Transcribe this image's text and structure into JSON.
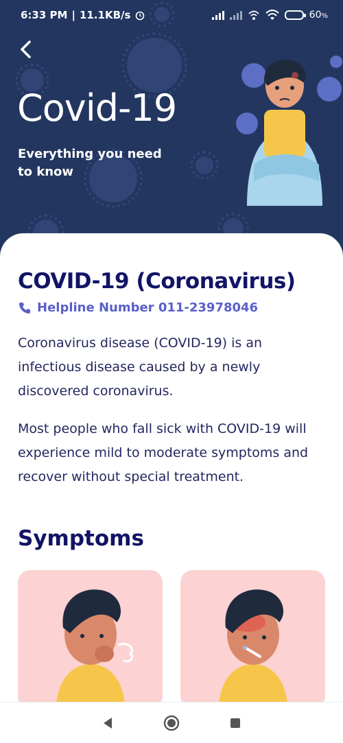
{
  "status": {
    "time": "6:33 PM",
    "speed": "11.1KB/s",
    "battery": "60",
    "battery_unit": "%",
    "battery_level": 0.6
  },
  "header": {
    "title": "Covid-19",
    "subtitle": "Everything you need to know"
  },
  "content": {
    "title": "COVID-19 (Coronavirus)",
    "helpline": "Helpline Number 011-23978046",
    "paragraphs": [
      "Coronavirus disease (COVID-19) is an infectious disease caused by a newly discovered coronavirus.",
      "Most people who fall sick with COVID-19 will experience mild to moderate symptoms and recover without special treatment."
    ],
    "symptoms_title": "Symptoms"
  },
  "icons": {
    "back": "back-arrow-icon",
    "phone": "phone-icon",
    "nav_back": "nav-back-icon",
    "nav_home": "nav-home-icon",
    "nav_recent": "nav-recent-icon"
  },
  "colors": {
    "header_bg": "#233660",
    "title": "#121466",
    "accent": "#5a5fc8",
    "card_bg": "#fcd2d2"
  }
}
